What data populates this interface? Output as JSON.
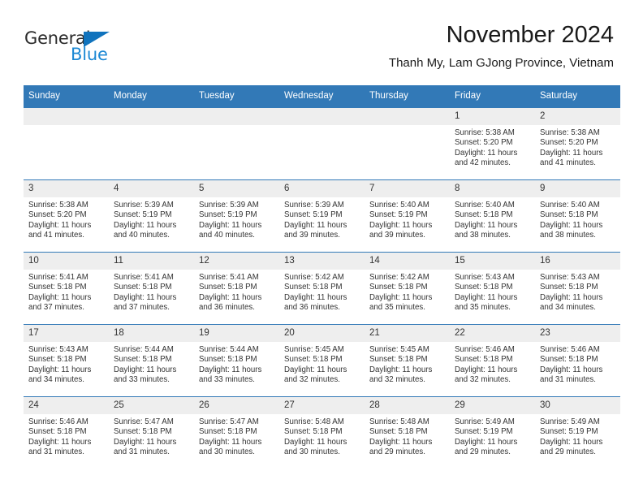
{
  "brand": {
    "name_part1": "General",
    "name_part2": "Blue",
    "triangle_color": "#1073bd",
    "blue_color": "#1c88d4"
  },
  "header": {
    "title": "November 2024",
    "subtitle": "Thanh My, Lam GJong Province, Vietnam"
  },
  "theme": {
    "header_blue": "#3279b7",
    "daynum_gray": "#eeeeee",
    "text": "#333333"
  },
  "weekday_headers": [
    "Sunday",
    "Monday",
    "Tuesday",
    "Wednesday",
    "Thursday",
    "Friday",
    "Saturday"
  ],
  "labels": {
    "sunrise_prefix": "Sunrise:",
    "sunset_prefix": "Sunset:",
    "daylight_prefix": "Daylight:"
  },
  "weeks": [
    [
      {
        "day": "",
        "empty": true
      },
      {
        "day": "",
        "empty": true
      },
      {
        "day": "",
        "empty": true
      },
      {
        "day": "",
        "empty": true
      },
      {
        "day": "",
        "empty": true
      },
      {
        "day": "1",
        "sunrise": "Sunrise: 5:38 AM",
        "sunset": "Sunset: 5:20 PM",
        "daylight1": "Daylight: 11 hours",
        "daylight2": "and 42 minutes."
      },
      {
        "day": "2",
        "sunrise": "Sunrise: 5:38 AM",
        "sunset": "Sunset: 5:20 PM",
        "daylight1": "Daylight: 11 hours",
        "daylight2": "and 41 minutes."
      }
    ],
    [
      {
        "day": "3",
        "sunrise": "Sunrise: 5:38 AM",
        "sunset": "Sunset: 5:20 PM",
        "daylight1": "Daylight: 11 hours",
        "daylight2": "and 41 minutes."
      },
      {
        "day": "4",
        "sunrise": "Sunrise: 5:39 AM",
        "sunset": "Sunset: 5:19 PM",
        "daylight1": "Daylight: 11 hours",
        "daylight2": "and 40 minutes."
      },
      {
        "day": "5",
        "sunrise": "Sunrise: 5:39 AM",
        "sunset": "Sunset: 5:19 PM",
        "daylight1": "Daylight: 11 hours",
        "daylight2": "and 40 minutes."
      },
      {
        "day": "6",
        "sunrise": "Sunrise: 5:39 AM",
        "sunset": "Sunset: 5:19 PM",
        "daylight1": "Daylight: 11 hours",
        "daylight2": "and 39 minutes."
      },
      {
        "day": "7",
        "sunrise": "Sunrise: 5:40 AM",
        "sunset": "Sunset: 5:19 PM",
        "daylight1": "Daylight: 11 hours",
        "daylight2": "and 39 minutes."
      },
      {
        "day": "8",
        "sunrise": "Sunrise: 5:40 AM",
        "sunset": "Sunset: 5:18 PM",
        "daylight1": "Daylight: 11 hours",
        "daylight2": "and 38 minutes."
      },
      {
        "day": "9",
        "sunrise": "Sunrise: 5:40 AM",
        "sunset": "Sunset: 5:18 PM",
        "daylight1": "Daylight: 11 hours",
        "daylight2": "and 38 minutes."
      }
    ],
    [
      {
        "day": "10",
        "sunrise": "Sunrise: 5:41 AM",
        "sunset": "Sunset: 5:18 PM",
        "daylight1": "Daylight: 11 hours",
        "daylight2": "and 37 minutes."
      },
      {
        "day": "11",
        "sunrise": "Sunrise: 5:41 AM",
        "sunset": "Sunset: 5:18 PM",
        "daylight1": "Daylight: 11 hours",
        "daylight2": "and 37 minutes."
      },
      {
        "day": "12",
        "sunrise": "Sunrise: 5:41 AM",
        "sunset": "Sunset: 5:18 PM",
        "daylight1": "Daylight: 11 hours",
        "daylight2": "and 36 minutes."
      },
      {
        "day": "13",
        "sunrise": "Sunrise: 5:42 AM",
        "sunset": "Sunset: 5:18 PM",
        "daylight1": "Daylight: 11 hours",
        "daylight2": "and 36 minutes."
      },
      {
        "day": "14",
        "sunrise": "Sunrise: 5:42 AM",
        "sunset": "Sunset: 5:18 PM",
        "daylight1": "Daylight: 11 hours",
        "daylight2": "and 35 minutes."
      },
      {
        "day": "15",
        "sunrise": "Sunrise: 5:43 AM",
        "sunset": "Sunset: 5:18 PM",
        "daylight1": "Daylight: 11 hours",
        "daylight2": "and 35 minutes."
      },
      {
        "day": "16",
        "sunrise": "Sunrise: 5:43 AM",
        "sunset": "Sunset: 5:18 PM",
        "daylight1": "Daylight: 11 hours",
        "daylight2": "and 34 minutes."
      }
    ],
    [
      {
        "day": "17",
        "sunrise": "Sunrise: 5:43 AM",
        "sunset": "Sunset: 5:18 PM",
        "daylight1": "Daylight: 11 hours",
        "daylight2": "and 34 minutes."
      },
      {
        "day": "18",
        "sunrise": "Sunrise: 5:44 AM",
        "sunset": "Sunset: 5:18 PM",
        "daylight1": "Daylight: 11 hours",
        "daylight2": "and 33 minutes."
      },
      {
        "day": "19",
        "sunrise": "Sunrise: 5:44 AM",
        "sunset": "Sunset: 5:18 PM",
        "daylight1": "Daylight: 11 hours",
        "daylight2": "and 33 minutes."
      },
      {
        "day": "20",
        "sunrise": "Sunrise: 5:45 AM",
        "sunset": "Sunset: 5:18 PM",
        "daylight1": "Daylight: 11 hours",
        "daylight2": "and 32 minutes."
      },
      {
        "day": "21",
        "sunrise": "Sunrise: 5:45 AM",
        "sunset": "Sunset: 5:18 PM",
        "daylight1": "Daylight: 11 hours",
        "daylight2": "and 32 minutes."
      },
      {
        "day": "22",
        "sunrise": "Sunrise: 5:46 AM",
        "sunset": "Sunset: 5:18 PM",
        "daylight1": "Daylight: 11 hours",
        "daylight2": "and 32 minutes."
      },
      {
        "day": "23",
        "sunrise": "Sunrise: 5:46 AM",
        "sunset": "Sunset: 5:18 PM",
        "daylight1": "Daylight: 11 hours",
        "daylight2": "and 31 minutes."
      }
    ],
    [
      {
        "day": "24",
        "sunrise": "Sunrise: 5:46 AM",
        "sunset": "Sunset: 5:18 PM",
        "daylight1": "Daylight: 11 hours",
        "daylight2": "and 31 minutes."
      },
      {
        "day": "25",
        "sunrise": "Sunrise: 5:47 AM",
        "sunset": "Sunset: 5:18 PM",
        "daylight1": "Daylight: 11 hours",
        "daylight2": "and 31 minutes."
      },
      {
        "day": "26",
        "sunrise": "Sunrise: 5:47 AM",
        "sunset": "Sunset: 5:18 PM",
        "daylight1": "Daylight: 11 hours",
        "daylight2": "and 30 minutes."
      },
      {
        "day": "27",
        "sunrise": "Sunrise: 5:48 AM",
        "sunset": "Sunset: 5:18 PM",
        "daylight1": "Daylight: 11 hours",
        "daylight2": "and 30 minutes."
      },
      {
        "day": "28",
        "sunrise": "Sunrise: 5:48 AM",
        "sunset": "Sunset: 5:18 PM",
        "daylight1": "Daylight: 11 hours",
        "daylight2": "and 29 minutes."
      },
      {
        "day": "29",
        "sunrise": "Sunrise: 5:49 AM",
        "sunset": "Sunset: 5:19 PM",
        "daylight1": "Daylight: 11 hours",
        "daylight2": "and 29 minutes."
      },
      {
        "day": "30",
        "sunrise": "Sunrise: 5:49 AM",
        "sunset": "Sunset: 5:19 PM",
        "daylight1": "Daylight: 11 hours",
        "daylight2": "and 29 minutes."
      }
    ]
  ]
}
